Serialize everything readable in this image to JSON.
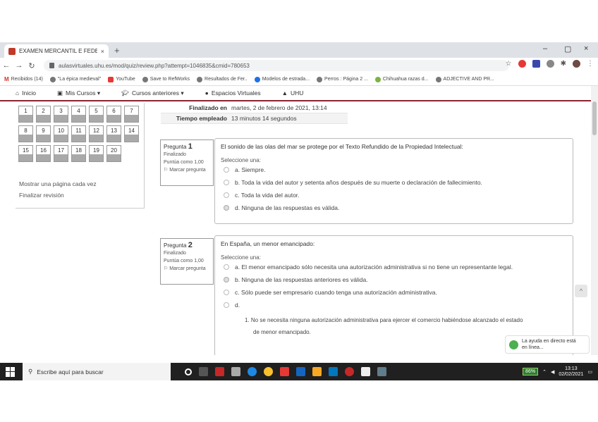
{
  "browser": {
    "tab_title": "EXAMEN MERCANTIL E FEDERIC",
    "tab_close": "×",
    "new_tab": "+",
    "window": {
      "minimize": "–",
      "restore": "▢",
      "close": "×"
    },
    "url": "aulasvirtuales.uhu.es/mod/quiz/review.php?attempt=1046835&cmid=780653",
    "bookmarks": [
      "Recibidos (14)",
      "\"La épica medieval\"",
      "YouTube",
      "Save to RefWorks",
      "Resultados de Fer..",
      "Modelos de estrada...",
      "Perros : Página 2 ...",
      "Chihuahua razas d...",
      "ADJECTIVE AND PR..."
    ]
  },
  "moodle_nav": {
    "items": [
      "Inicio",
      "Mis Cursos ▾",
      "Cursos anteriores ▾",
      "Espacios Virtuales",
      "UHU"
    ]
  },
  "quiz_nav": {
    "buttons": [
      "1",
      "2",
      "3",
      "4",
      "5",
      "6",
      "7",
      "8",
      "9",
      "10",
      "11",
      "12",
      "13",
      "14",
      "15",
      "16",
      "17",
      "18",
      "19",
      "20"
    ],
    "show_one_page": "Mostrar una página cada vez",
    "finish_review": "Finalizar revisión"
  },
  "summary": {
    "rows": [
      {
        "label": "Finalizado en",
        "value": "martes, 2 de febrero de 2021, 13:14"
      },
      {
        "label": "Tiempo empleado",
        "value": "13 minutos 14 segundos"
      }
    ]
  },
  "questions": [
    {
      "label": "Pregunta",
      "number": "1",
      "state": "Finalizado",
      "points": "Puntúa como 1,00",
      "flag": "Marcar pregunta",
      "text": "El sonido de las olas del mar se protege por el Texto Refundido de la Propiedad Intelectual:",
      "prompt": "Seleccione una:",
      "options": [
        "a. Siempre.",
        "b. Toda la vida del autor y setenta años después de su muerte o declaración de fallecimiento.",
        "c. Toda la vida del autor.",
        "d. Ninguna de las respuestas es válida."
      ]
    },
    {
      "label": "Pregunta",
      "number": "2",
      "state": "Finalizado",
      "points": "Puntúa como 1,00",
      "flag": "Marcar pregunta",
      "text": "En España, un menor emancipado:",
      "prompt": "Seleccione una:",
      "options": [
        "a. El menor emancipado sólo necesita una autorización administrativa si no tiene un representante legal.",
        "b. Ninguna de las respuestas anteriores es válida.",
        "c. Sólo puede ser empresario cuando tenga una autorización administrativa.",
        "d."
      ],
      "option_d_sub": [
        "1. No se necesita ninguna autorización administrativa para ejercer el comercio habiéndose alcanzado el estado",
        "de menor emancipado."
      ]
    }
  ],
  "help_chip": {
    "line1": "La ayuda en directo está",
    "line2": "en línea..."
  },
  "taskbar": {
    "search_placeholder": "Escribe aquí para buscar",
    "battery": "86%",
    "time": "13:13",
    "date": "02/02/2021"
  }
}
